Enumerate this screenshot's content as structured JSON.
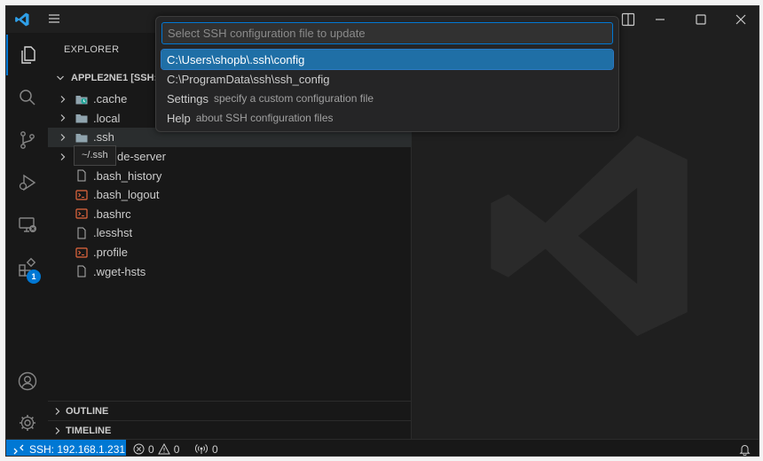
{
  "quickpick": {
    "placeholder": "Select SSH configuration file to update",
    "items": [
      {
        "label": "C:\\Users\\shopb\\.ssh\\config",
        "description": ""
      },
      {
        "label": "C:\\ProgramData\\ssh\\ssh_config",
        "description": ""
      },
      {
        "label": "Settings",
        "description": "specify a custom configuration file"
      },
      {
        "label": "Help",
        "description": "about SSH configuration files"
      }
    ]
  },
  "activitybar": {
    "extensions_badge": "1"
  },
  "sidebar": {
    "title": "EXPLORER",
    "section_title": "APPLE2NE1 [SSH: 1",
    "tree": [
      {
        "name": ".cache"
      },
      {
        "name": ".local"
      },
      {
        "name": ".ssh"
      },
      {
        "name": "de-server"
      },
      {
        "name": ".bash_history"
      },
      {
        "name": ".bash_logout"
      },
      {
        "name": ".bashrc"
      },
      {
        "name": ".lesshst"
      },
      {
        "name": ".profile"
      },
      {
        "name": ".wget-hsts"
      }
    ],
    "tooltip": "~/.ssh",
    "outline_label": "OUTLINE",
    "timeline_label": "TIMELINE"
  },
  "statusbar": {
    "remote": "SSH: 192.168.1.231",
    "errors": "0",
    "warnings": "0",
    "ports": "0"
  },
  "colors": {
    "accent": "#0078d4",
    "selected_item": "#1f6fa6",
    "background": "#1f1f1f",
    "sidebar": "#181818",
    "terminal_icon": "#e5673e"
  }
}
